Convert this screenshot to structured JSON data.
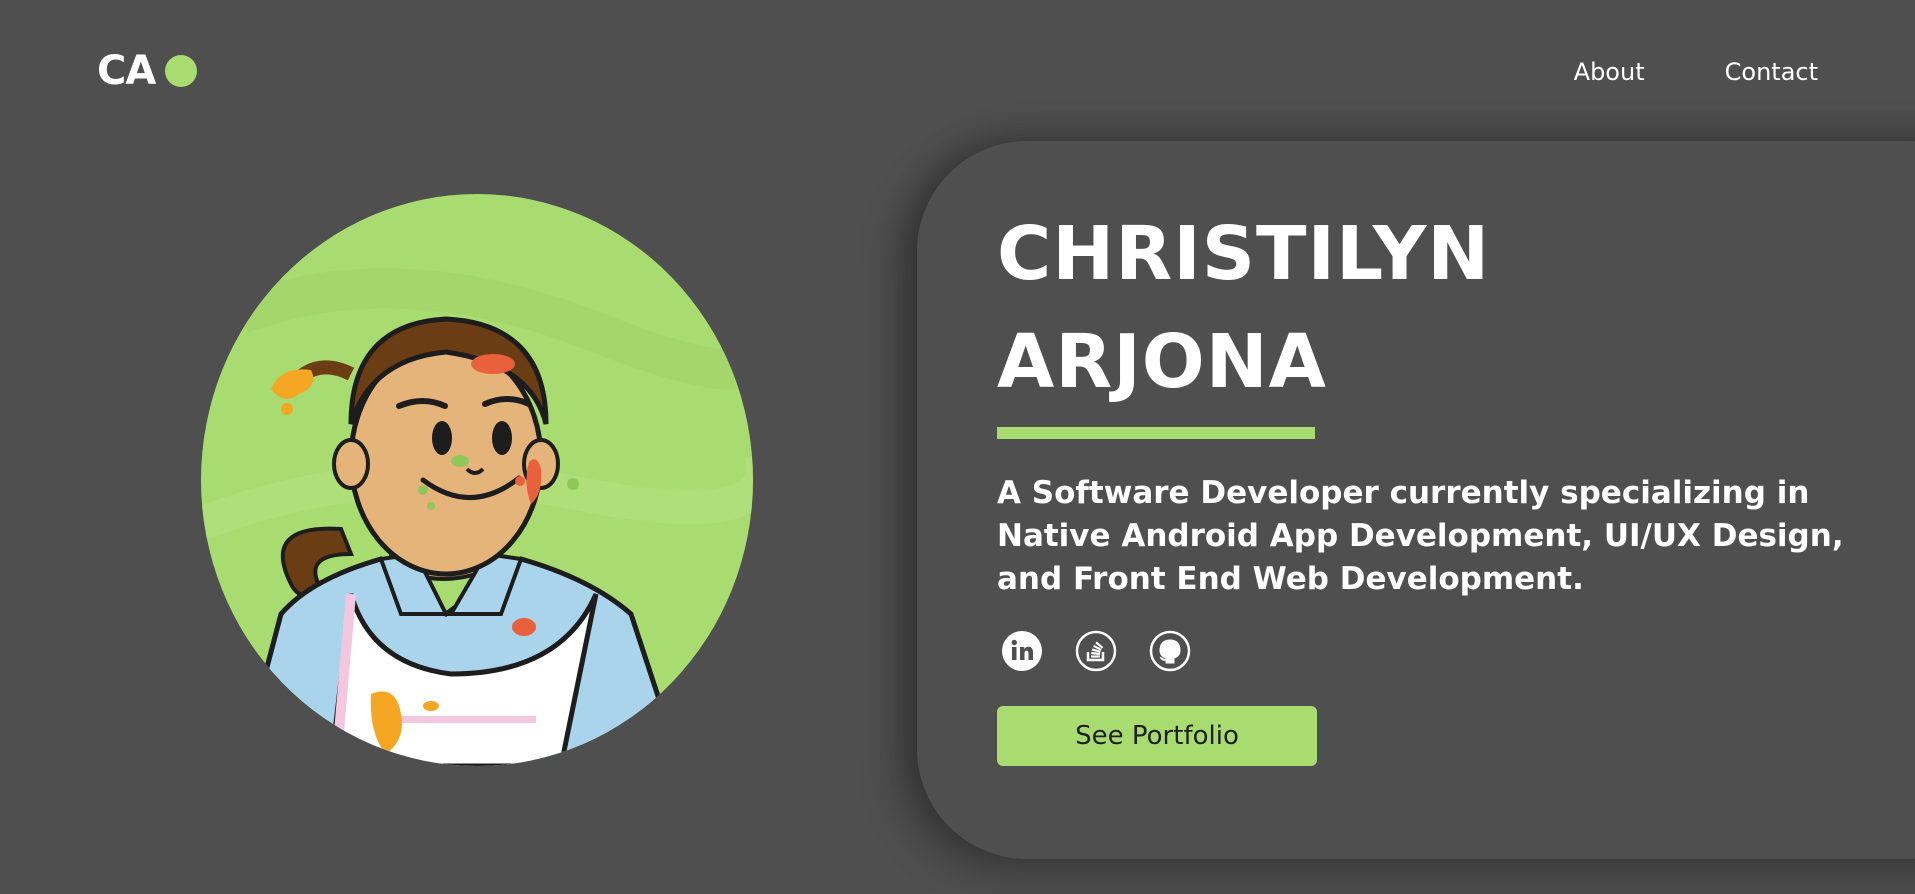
{
  "header": {
    "logo_text": "CA",
    "nav": [
      {
        "label": "About"
      },
      {
        "label": "Contact"
      }
    ]
  },
  "hero": {
    "first_name": "CHRISTILYN",
    "last_name": "ARJONA",
    "tagline": "A Software Developer currently specializing in Native Android App Development, UI/UX Design, and Front End Web Development.",
    "cta_label": "See Portfolio",
    "socials": [
      {
        "icon": "linkedin-icon"
      },
      {
        "icon": "stackoverflow-icon"
      },
      {
        "icon": "github-icon"
      }
    ]
  },
  "colors": {
    "background": "#4f4f4f",
    "accent": "#a8dc70",
    "text": "#ffffff",
    "button_text": "#1f1f1f"
  }
}
